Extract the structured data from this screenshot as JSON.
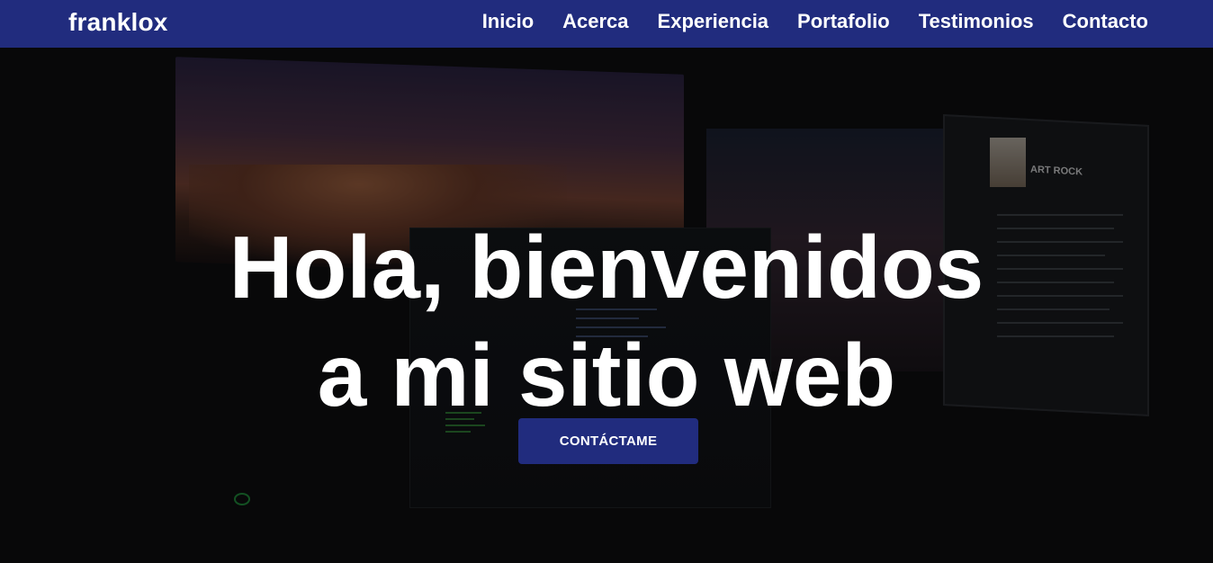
{
  "brand": {
    "name": "franklox"
  },
  "nav": {
    "items": [
      {
        "label": "Inicio"
      },
      {
        "label": "Acerca"
      },
      {
        "label": "Experiencia"
      },
      {
        "label": "Portafolio"
      },
      {
        "label": "Testimonios"
      },
      {
        "label": "Contacto"
      }
    ]
  },
  "hero": {
    "headline_line1": "Hola, bienvenidos",
    "headline_line2": "a mi sitio web",
    "cta_label": "CONTÁCTAME",
    "background_photo_text": "ART ROCK"
  },
  "colors": {
    "navbar": "#212c7e",
    "button": "#212c7e",
    "text": "#ffffff"
  }
}
